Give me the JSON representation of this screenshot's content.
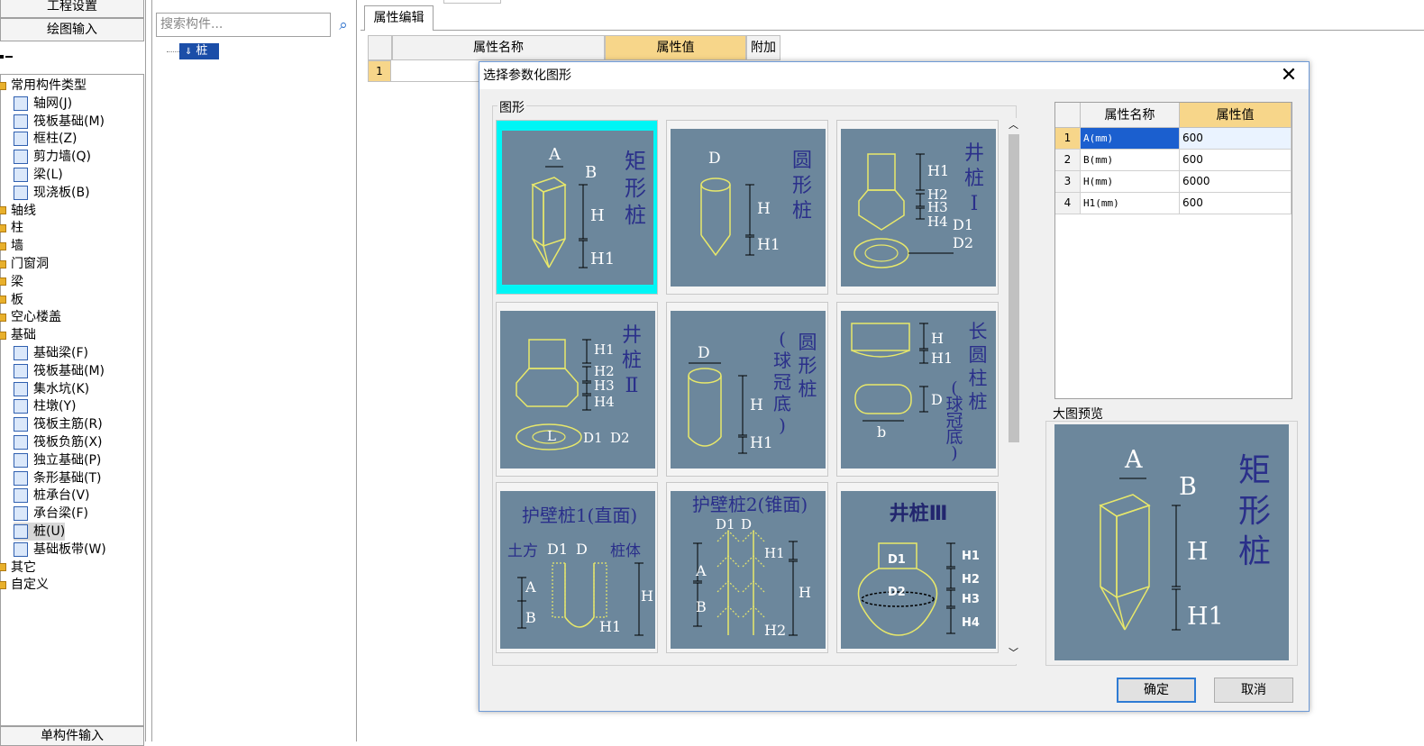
{
  "left_panel": {
    "btn_top": "工程设置",
    "btn_draw": "绘图输入",
    "bottom_label": "单构件输入",
    "tree": [
      {
        "label": "常用构件类型",
        "kind": "folder"
      },
      {
        "label": "轴网(J)",
        "kind": "item"
      },
      {
        "label": "筏板基础(M)",
        "kind": "item"
      },
      {
        "label": "框柱(Z)",
        "kind": "item"
      },
      {
        "label": "剪力墙(Q)",
        "kind": "item"
      },
      {
        "label": "梁(L)",
        "kind": "item"
      },
      {
        "label": "现浇板(B)",
        "kind": "item"
      },
      {
        "label": "轴线",
        "kind": "folder"
      },
      {
        "label": "柱",
        "kind": "folder"
      },
      {
        "label": "墙",
        "kind": "folder"
      },
      {
        "label": "门窗洞",
        "kind": "folder"
      },
      {
        "label": "梁",
        "kind": "folder"
      },
      {
        "label": "板",
        "kind": "folder"
      },
      {
        "label": "空心楼盖",
        "kind": "folder"
      },
      {
        "label": "基础",
        "kind": "folder"
      },
      {
        "label": "基础梁(F)",
        "kind": "item"
      },
      {
        "label": "筏板基础(M)",
        "kind": "item"
      },
      {
        "label": "集水坑(K)",
        "kind": "item"
      },
      {
        "label": "柱墩(Y)",
        "kind": "item"
      },
      {
        "label": "筏板主筋(R)",
        "kind": "item"
      },
      {
        "label": "筏板负筋(X)",
        "kind": "item"
      },
      {
        "label": "独立基础(P)",
        "kind": "item"
      },
      {
        "label": "条形基础(T)",
        "kind": "item"
      },
      {
        "label": "桩承台(V)",
        "kind": "item"
      },
      {
        "label": "承台梁(F)",
        "kind": "item"
      },
      {
        "label": "桩(U)",
        "kind": "item",
        "selected": true
      },
      {
        "label": "基础板带(W)",
        "kind": "item"
      },
      {
        "label": "其它",
        "kind": "folder"
      },
      {
        "label": "自定义",
        "kind": "folder"
      }
    ]
  },
  "middle_panel": {
    "search_placeholder": "搜索构件...",
    "search_icon": "search-icon",
    "selected_node": "桩"
  },
  "right_area": {
    "tab_label": "属性编辑",
    "col_name": "属性名称",
    "col_value": "属性值",
    "col_extra": "附加",
    "row1": "1"
  },
  "dialog": {
    "title": "选择参数化图形",
    "group_label": "图形",
    "shapes": [
      {
        "title": "矩形桩",
        "labels": [
          "A",
          "B",
          "H",
          "H1"
        ]
      },
      {
        "title": "圆形桩",
        "labels": [
          "D",
          "H",
          "H1"
        ]
      },
      {
        "title": "井桩Ⅰ",
        "labels": [
          "H1",
          "H2",
          "H3",
          "H4",
          "D1",
          "D2"
        ]
      },
      {
        "title": "井桩Ⅱ",
        "labels": [
          "H1",
          "H2",
          "H3",
          "H4",
          "L",
          "D1",
          "D2"
        ]
      },
      {
        "title": "圆形桩(球冠底)",
        "labels": [
          "D",
          "H",
          "H1"
        ]
      },
      {
        "title": "长圆柱桩(球冠底)",
        "labels": [
          "H",
          "H1",
          "D",
          "b"
        ]
      },
      {
        "title": "护壁桩1(直面)",
        "labels": [
          "土方",
          "D1",
          "D",
          "桩体",
          "A",
          "B",
          "H",
          "H1"
        ]
      },
      {
        "title": "护壁桩2(锥面)",
        "labels": [
          "D1",
          "D",
          "H1",
          "A",
          "B",
          "H",
          "H2"
        ]
      },
      {
        "title": "井桩Ⅲ",
        "labels": [
          "D1",
          "D2",
          "H1",
          "H2",
          "H3",
          "H4"
        ]
      }
    ],
    "props_header": {
      "name": "属性名称",
      "value": "属性值"
    },
    "props": [
      {
        "idx": "1",
        "name": "A(mm)",
        "value": "600"
      },
      {
        "idx": "2",
        "name": "B(mm)",
        "value": "600"
      },
      {
        "idx": "3",
        "name": "H(mm)",
        "value": "6000"
      },
      {
        "idx": "4",
        "name": "H1(mm)",
        "value": "600"
      }
    ],
    "preview_label": "大图预览",
    "preview": {
      "title": "矩形桩",
      "labels": [
        "A",
        "B",
        "H",
        "H1"
      ]
    },
    "ok_label": "确定",
    "cancel_label": "取消",
    "close_icon": "close-icon"
  },
  "colors": {
    "thumb_bg": "#6c879c",
    "line": "#e8e86a",
    "active": "#00f5f5",
    "accent": "#f7d68a"
  }
}
